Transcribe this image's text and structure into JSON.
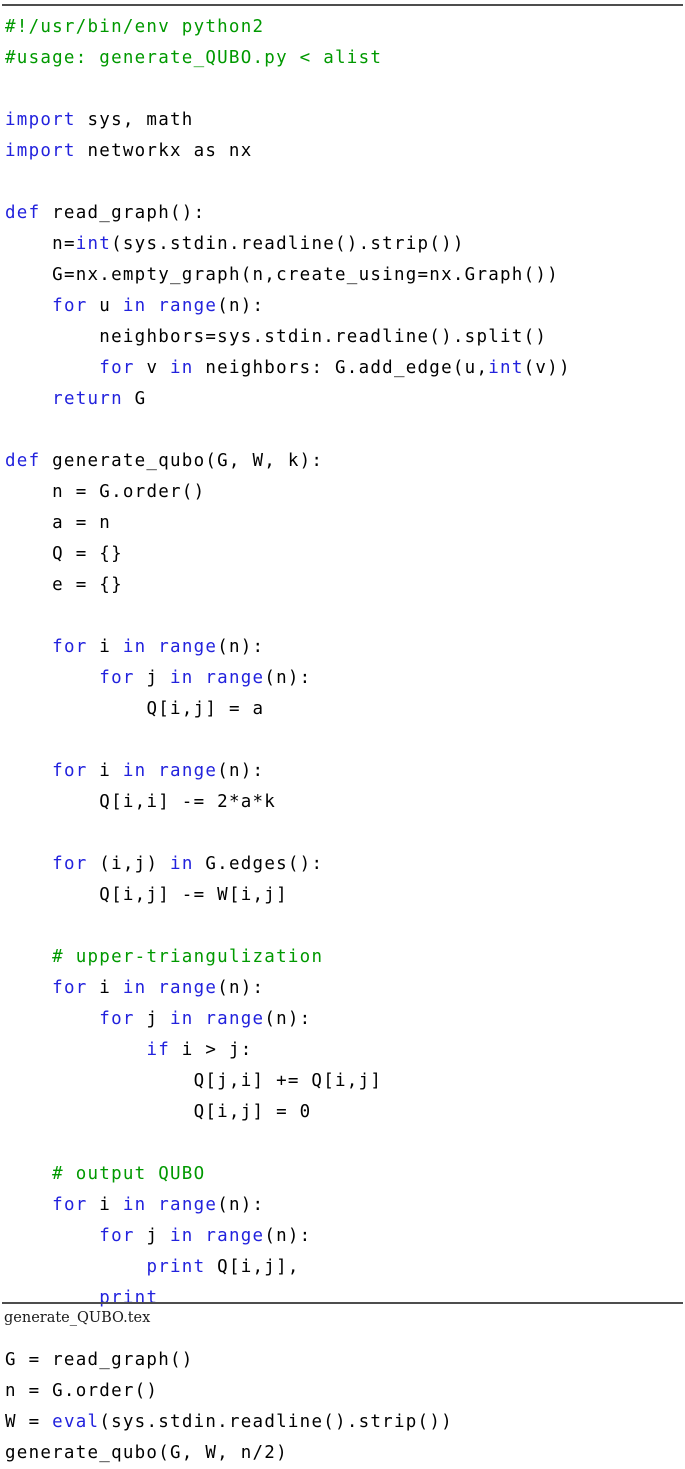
{
  "document": {
    "caption": "generate_QUBO.tex",
    "colors": {
      "comment": "#009900",
      "keyword": "#2222dd",
      "plain": "#000000",
      "rule": "#4d4d4d",
      "background": "#ffffff"
    }
  },
  "listing": {
    "language": "Python 2",
    "lines": [
      {
        "n": 1,
        "indent": 0,
        "tokens": [
          {
            "t": "#!/usr/bin/env python2",
            "c": "cm"
          }
        ]
      },
      {
        "n": 2,
        "indent": 0,
        "tokens": [
          {
            "t": "#usage: generate_QUBO.py < alist",
            "c": "cm"
          }
        ]
      },
      {
        "n": 3,
        "indent": 0,
        "tokens": []
      },
      {
        "n": 4,
        "indent": 0,
        "tokens": [
          {
            "t": "import",
            "c": "kw"
          },
          {
            "t": " sys, math",
            "c": "pl"
          }
        ]
      },
      {
        "n": 5,
        "indent": 0,
        "tokens": [
          {
            "t": "import",
            "c": "kw"
          },
          {
            "t": " networkx as nx",
            "c": "pl"
          }
        ]
      },
      {
        "n": 6,
        "indent": 0,
        "tokens": []
      },
      {
        "n": 7,
        "indent": 0,
        "tokens": [
          {
            "t": "def",
            "c": "kw"
          },
          {
            "t": " read_graph():",
            "c": "pl"
          }
        ]
      },
      {
        "n": 8,
        "indent": 1,
        "tokens": [
          {
            "t": "n=",
            "c": "pl"
          },
          {
            "t": "int",
            "c": "kw"
          },
          {
            "t": "(sys.stdin.readline().strip())",
            "c": "pl"
          }
        ]
      },
      {
        "n": 9,
        "indent": 1,
        "tokens": [
          {
            "t": "G=nx.empty_graph(n,create_using=nx.Graph())",
            "c": "pl"
          }
        ]
      },
      {
        "n": 10,
        "indent": 1,
        "tokens": [
          {
            "t": "for",
            "c": "kw"
          },
          {
            "t": " u ",
            "c": "pl"
          },
          {
            "t": "in",
            "c": "kw"
          },
          {
            "t": " ",
            "c": "pl"
          },
          {
            "t": "range",
            "c": "kw"
          },
          {
            "t": "(n):",
            "c": "pl"
          }
        ]
      },
      {
        "n": 11,
        "indent": 2,
        "tokens": [
          {
            "t": "neighbors=sys.stdin.readline().split()",
            "c": "pl"
          }
        ]
      },
      {
        "n": 12,
        "indent": 2,
        "tokens": [
          {
            "t": "for",
            "c": "kw"
          },
          {
            "t": " v ",
            "c": "pl"
          },
          {
            "t": "in",
            "c": "kw"
          },
          {
            "t": " neighbors: G.add_edge(u,",
            "c": "pl"
          },
          {
            "t": "int",
            "c": "kw"
          },
          {
            "t": "(v))",
            "c": "pl"
          }
        ]
      },
      {
        "n": 13,
        "indent": 1,
        "tokens": [
          {
            "t": "return",
            "c": "kw"
          },
          {
            "t": " G",
            "c": "pl"
          }
        ]
      },
      {
        "n": 14,
        "indent": 0,
        "tokens": []
      },
      {
        "n": 15,
        "indent": 0,
        "tokens": [
          {
            "t": "def",
            "c": "kw"
          },
          {
            "t": " generate_qubo(G, W, k):",
            "c": "pl"
          }
        ]
      },
      {
        "n": 16,
        "indent": 1,
        "tokens": [
          {
            "t": "n = G.order()",
            "c": "pl"
          }
        ]
      },
      {
        "n": 17,
        "indent": 1,
        "tokens": [
          {
            "t": "a = n",
            "c": "pl"
          }
        ]
      },
      {
        "n": 18,
        "indent": 1,
        "tokens": [
          {
            "t": "Q = {}",
            "c": "pl"
          }
        ]
      },
      {
        "n": 19,
        "indent": 1,
        "tokens": [
          {
            "t": "e = {}",
            "c": "pl"
          }
        ]
      },
      {
        "n": 20,
        "indent": 0,
        "tokens": []
      },
      {
        "n": 21,
        "indent": 1,
        "tokens": [
          {
            "t": "for",
            "c": "kw"
          },
          {
            "t": " i ",
            "c": "pl"
          },
          {
            "t": "in",
            "c": "kw"
          },
          {
            "t": " ",
            "c": "pl"
          },
          {
            "t": "range",
            "c": "kw"
          },
          {
            "t": "(n):",
            "c": "pl"
          }
        ]
      },
      {
        "n": 22,
        "indent": 2,
        "tokens": [
          {
            "t": "for",
            "c": "kw"
          },
          {
            "t": " j ",
            "c": "pl"
          },
          {
            "t": "in",
            "c": "kw"
          },
          {
            "t": " ",
            "c": "pl"
          },
          {
            "t": "range",
            "c": "kw"
          },
          {
            "t": "(n):",
            "c": "pl"
          }
        ]
      },
      {
        "n": 23,
        "indent": 3,
        "tokens": [
          {
            "t": "Q[i,j] = a",
            "c": "pl"
          }
        ]
      },
      {
        "n": 24,
        "indent": 0,
        "tokens": []
      },
      {
        "n": 25,
        "indent": 1,
        "tokens": [
          {
            "t": "for",
            "c": "kw"
          },
          {
            "t": " i ",
            "c": "pl"
          },
          {
            "t": "in",
            "c": "kw"
          },
          {
            "t": " ",
            "c": "pl"
          },
          {
            "t": "range",
            "c": "kw"
          },
          {
            "t": "(n):",
            "c": "pl"
          }
        ]
      },
      {
        "n": 26,
        "indent": 2,
        "tokens": [
          {
            "t": "Q[i,i] -= 2*a*k",
            "c": "pl"
          }
        ]
      },
      {
        "n": 27,
        "indent": 0,
        "tokens": []
      },
      {
        "n": 28,
        "indent": 1,
        "tokens": [
          {
            "t": "for",
            "c": "kw"
          },
          {
            "t": " (i,j) ",
            "c": "pl"
          },
          {
            "t": "in",
            "c": "kw"
          },
          {
            "t": " G.edges():",
            "c": "pl"
          }
        ]
      },
      {
        "n": 29,
        "indent": 2,
        "tokens": [
          {
            "t": "Q[i,j] -= W[i,j]",
            "c": "pl"
          }
        ]
      },
      {
        "n": 30,
        "indent": 0,
        "tokens": []
      },
      {
        "n": 31,
        "indent": 1,
        "tokens": [
          {
            "t": "# upper-triangulization",
            "c": "cm"
          }
        ]
      },
      {
        "n": 32,
        "indent": 1,
        "tokens": [
          {
            "t": "for",
            "c": "kw"
          },
          {
            "t": " i ",
            "c": "pl"
          },
          {
            "t": "in",
            "c": "kw"
          },
          {
            "t": " ",
            "c": "pl"
          },
          {
            "t": "range",
            "c": "kw"
          },
          {
            "t": "(n):",
            "c": "pl"
          }
        ]
      },
      {
        "n": 33,
        "indent": 2,
        "tokens": [
          {
            "t": "for",
            "c": "kw"
          },
          {
            "t": " j ",
            "c": "pl"
          },
          {
            "t": "in",
            "c": "kw"
          },
          {
            "t": " ",
            "c": "pl"
          },
          {
            "t": "range",
            "c": "kw"
          },
          {
            "t": "(n):",
            "c": "pl"
          }
        ]
      },
      {
        "n": 34,
        "indent": 3,
        "tokens": [
          {
            "t": "if",
            "c": "kw"
          },
          {
            "t": " i > j:",
            "c": "pl"
          }
        ]
      },
      {
        "n": 35,
        "indent": 4,
        "tokens": [
          {
            "t": "Q[j,i] += Q[i,j]",
            "c": "pl"
          }
        ]
      },
      {
        "n": 36,
        "indent": 4,
        "tokens": [
          {
            "t": "Q[i,j] = 0",
            "c": "pl"
          }
        ]
      },
      {
        "n": 37,
        "indent": 0,
        "tokens": []
      },
      {
        "n": 38,
        "indent": 1,
        "tokens": [
          {
            "t": "# output QUBO",
            "c": "cm"
          }
        ]
      },
      {
        "n": 39,
        "indent": 1,
        "tokens": [
          {
            "t": "for",
            "c": "kw"
          },
          {
            "t": " i ",
            "c": "pl"
          },
          {
            "t": "in",
            "c": "kw"
          },
          {
            "t": " ",
            "c": "pl"
          },
          {
            "t": "range",
            "c": "kw"
          },
          {
            "t": "(n):",
            "c": "pl"
          }
        ]
      },
      {
        "n": 40,
        "indent": 2,
        "tokens": [
          {
            "t": "for",
            "c": "kw"
          },
          {
            "t": " j ",
            "c": "pl"
          },
          {
            "t": "in",
            "c": "kw"
          },
          {
            "t": " ",
            "c": "pl"
          },
          {
            "t": "range",
            "c": "kw"
          },
          {
            "t": "(n):",
            "c": "pl"
          }
        ]
      },
      {
        "n": 41,
        "indent": 3,
        "tokens": [
          {
            "t": "print",
            "c": "kw"
          },
          {
            "t": " Q[i,j],",
            "c": "pl"
          }
        ]
      },
      {
        "n": 42,
        "indent": 2,
        "tokens": [
          {
            "t": "print",
            "c": "kw"
          }
        ]
      },
      {
        "n": 43,
        "indent": 0,
        "tokens": []
      },
      {
        "n": 44,
        "indent": 0,
        "tokens": [
          {
            "t": "G = read_graph()",
            "c": "pl"
          }
        ]
      },
      {
        "n": 45,
        "indent": 0,
        "tokens": [
          {
            "t": "n = G.order()",
            "c": "pl"
          }
        ]
      },
      {
        "n": 46,
        "indent": 0,
        "tokens": [
          {
            "t": "W = ",
            "c": "pl"
          },
          {
            "t": "eval",
            "c": "kw"
          },
          {
            "t": "(sys.stdin.readline().strip())",
            "c": "pl"
          }
        ]
      },
      {
        "n": 47,
        "indent": 0,
        "tokens": [
          {
            "t": "generate_qubo(G, W, n/2)",
            "c": "pl"
          }
        ]
      }
    ]
  }
}
